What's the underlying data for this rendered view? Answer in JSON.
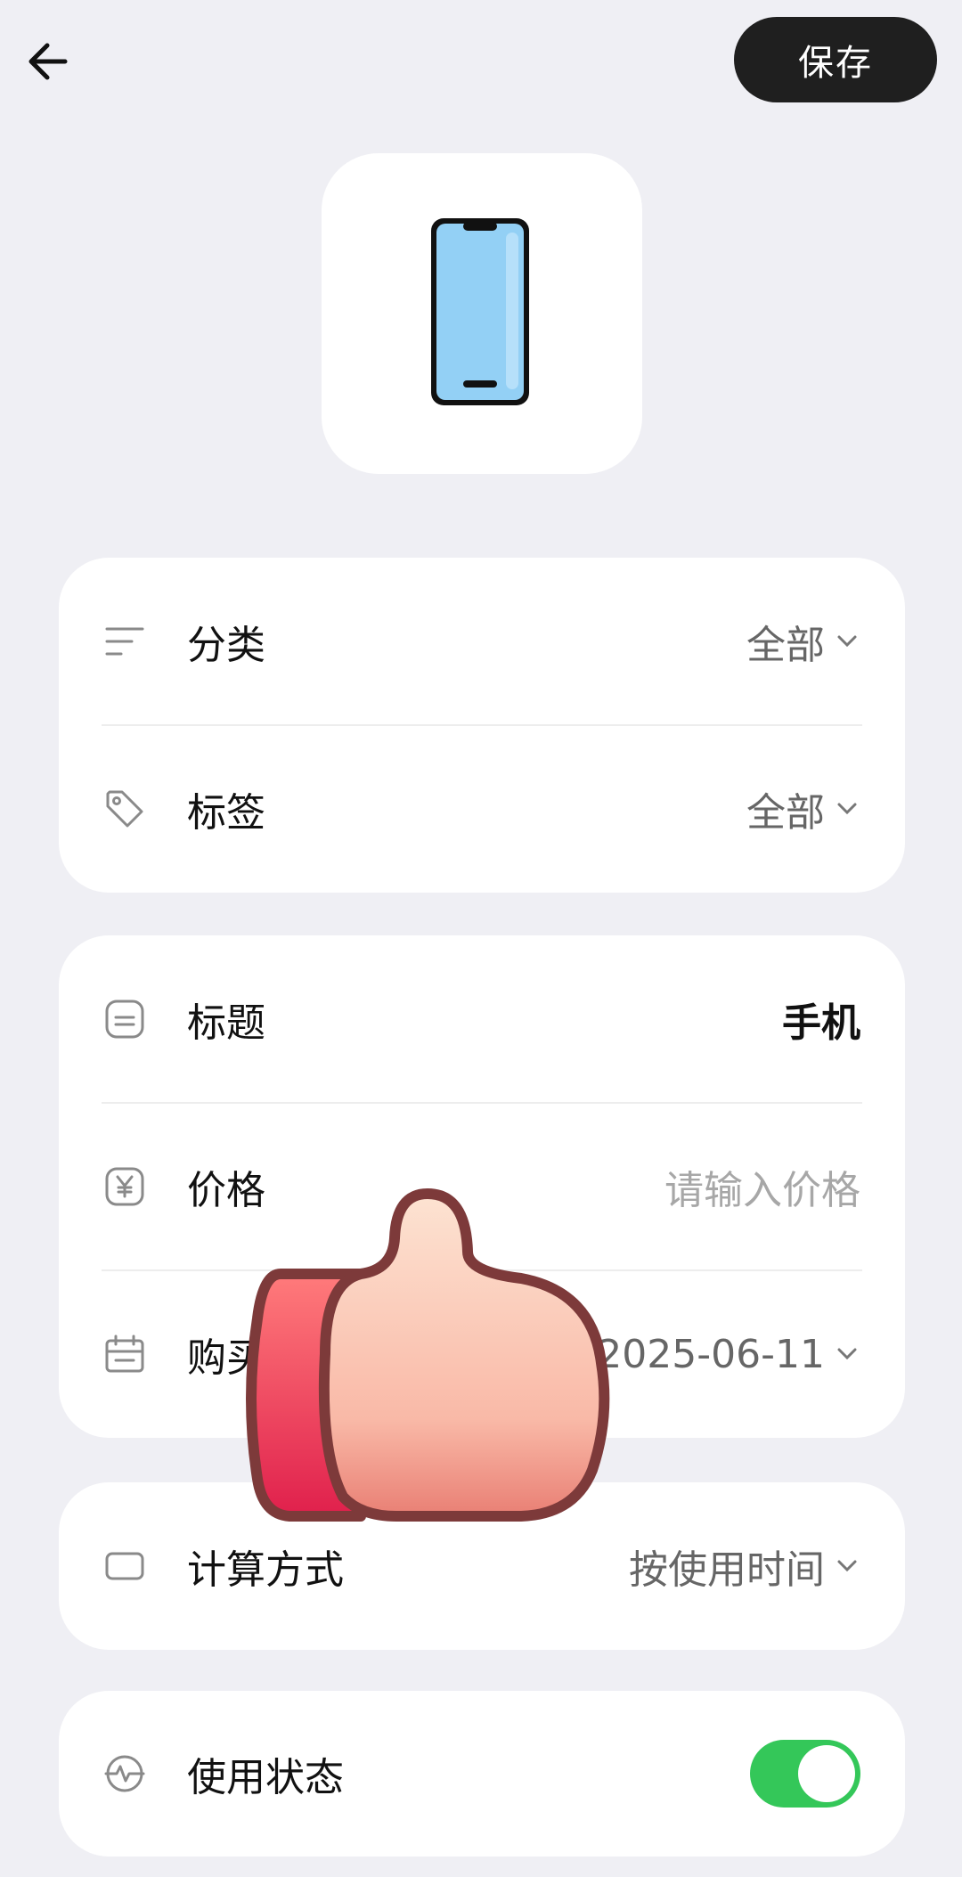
{
  "header": {
    "save_label": "保存"
  },
  "card1": {
    "rows": [
      {
        "label": "分类",
        "value": "全部"
      },
      {
        "label": "标签",
        "value": "全部"
      }
    ]
  },
  "card2": {
    "rows": [
      {
        "label": "标题",
        "value": "手机"
      },
      {
        "label": "价格",
        "placeholder": "请输入价格"
      },
      {
        "label": "购买日期",
        "value": "2025-06-11"
      }
    ]
  },
  "card3": {
    "label": "计算方式",
    "value": "按使用时间"
  },
  "card4": {
    "label": "使用状态",
    "toggle_on": true
  },
  "colors": {
    "accent": "#34c759",
    "save_bg": "#1f1f1f",
    "page_bg": "#efeff4"
  }
}
